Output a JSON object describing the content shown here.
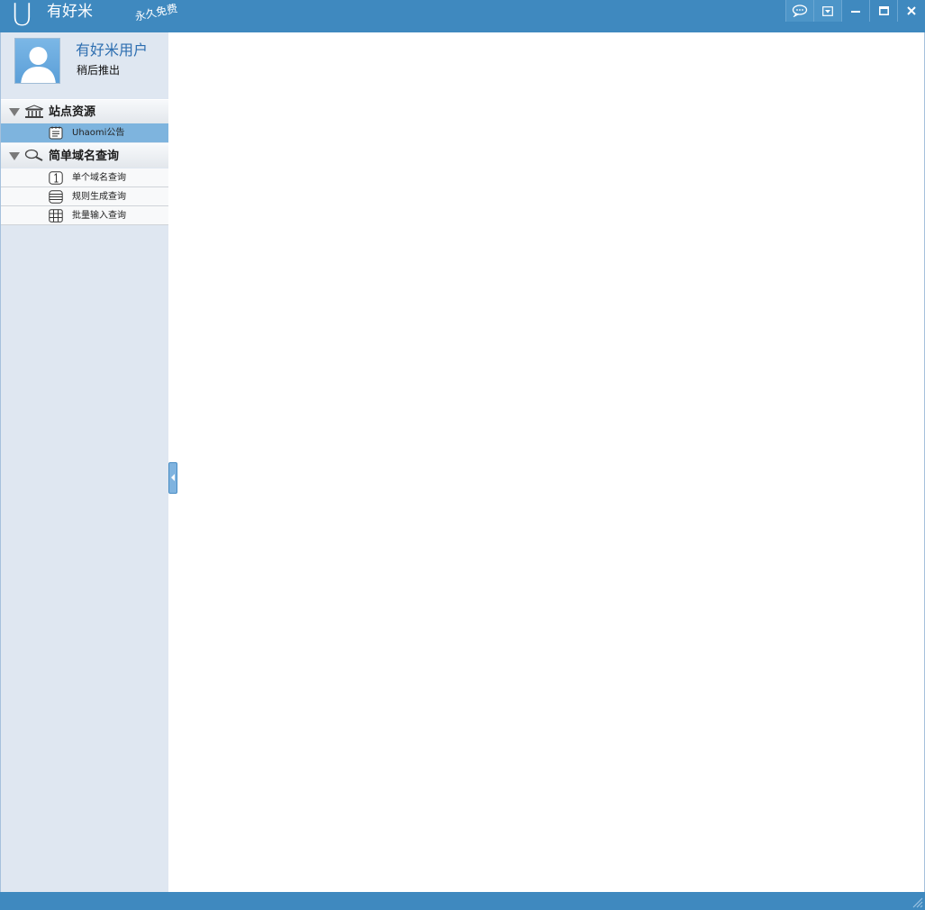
{
  "window": {
    "logo_letter": "U",
    "app_title": "有好米",
    "slogan": "永久免费",
    "controls": [
      "chat-icon",
      "dropdown-menu-icon",
      "minimize-icon",
      "maximize-icon",
      "close-icon"
    ]
  },
  "user": {
    "name": "有好米用户",
    "logout_label": "稍后推出"
  },
  "sidebar": {
    "groups": [
      {
        "label": "站点资源",
        "icon": "bank-icon",
        "expanded": true,
        "items": [
          {
            "label": "Uhaomi公告",
            "icon": "notice-icon",
            "selected": true
          }
        ]
      },
      {
        "label": "简单域名查询",
        "icon": "search-icon",
        "expanded": true,
        "items": [
          {
            "label": "单个域名查询",
            "icon": "number-one-icon",
            "selected": false
          },
          {
            "label": "规则生成查询",
            "icon": "list-icon",
            "selected": false
          },
          {
            "label": "批量输入查询",
            "icon": "grid-icon",
            "selected": false
          }
        ]
      }
    ]
  },
  "colors": {
    "titlebar": "#3f89bf",
    "sidebar_bg": "#dfe7f1",
    "selected_item": "#7eb4de",
    "username": "#2d6eb0"
  }
}
